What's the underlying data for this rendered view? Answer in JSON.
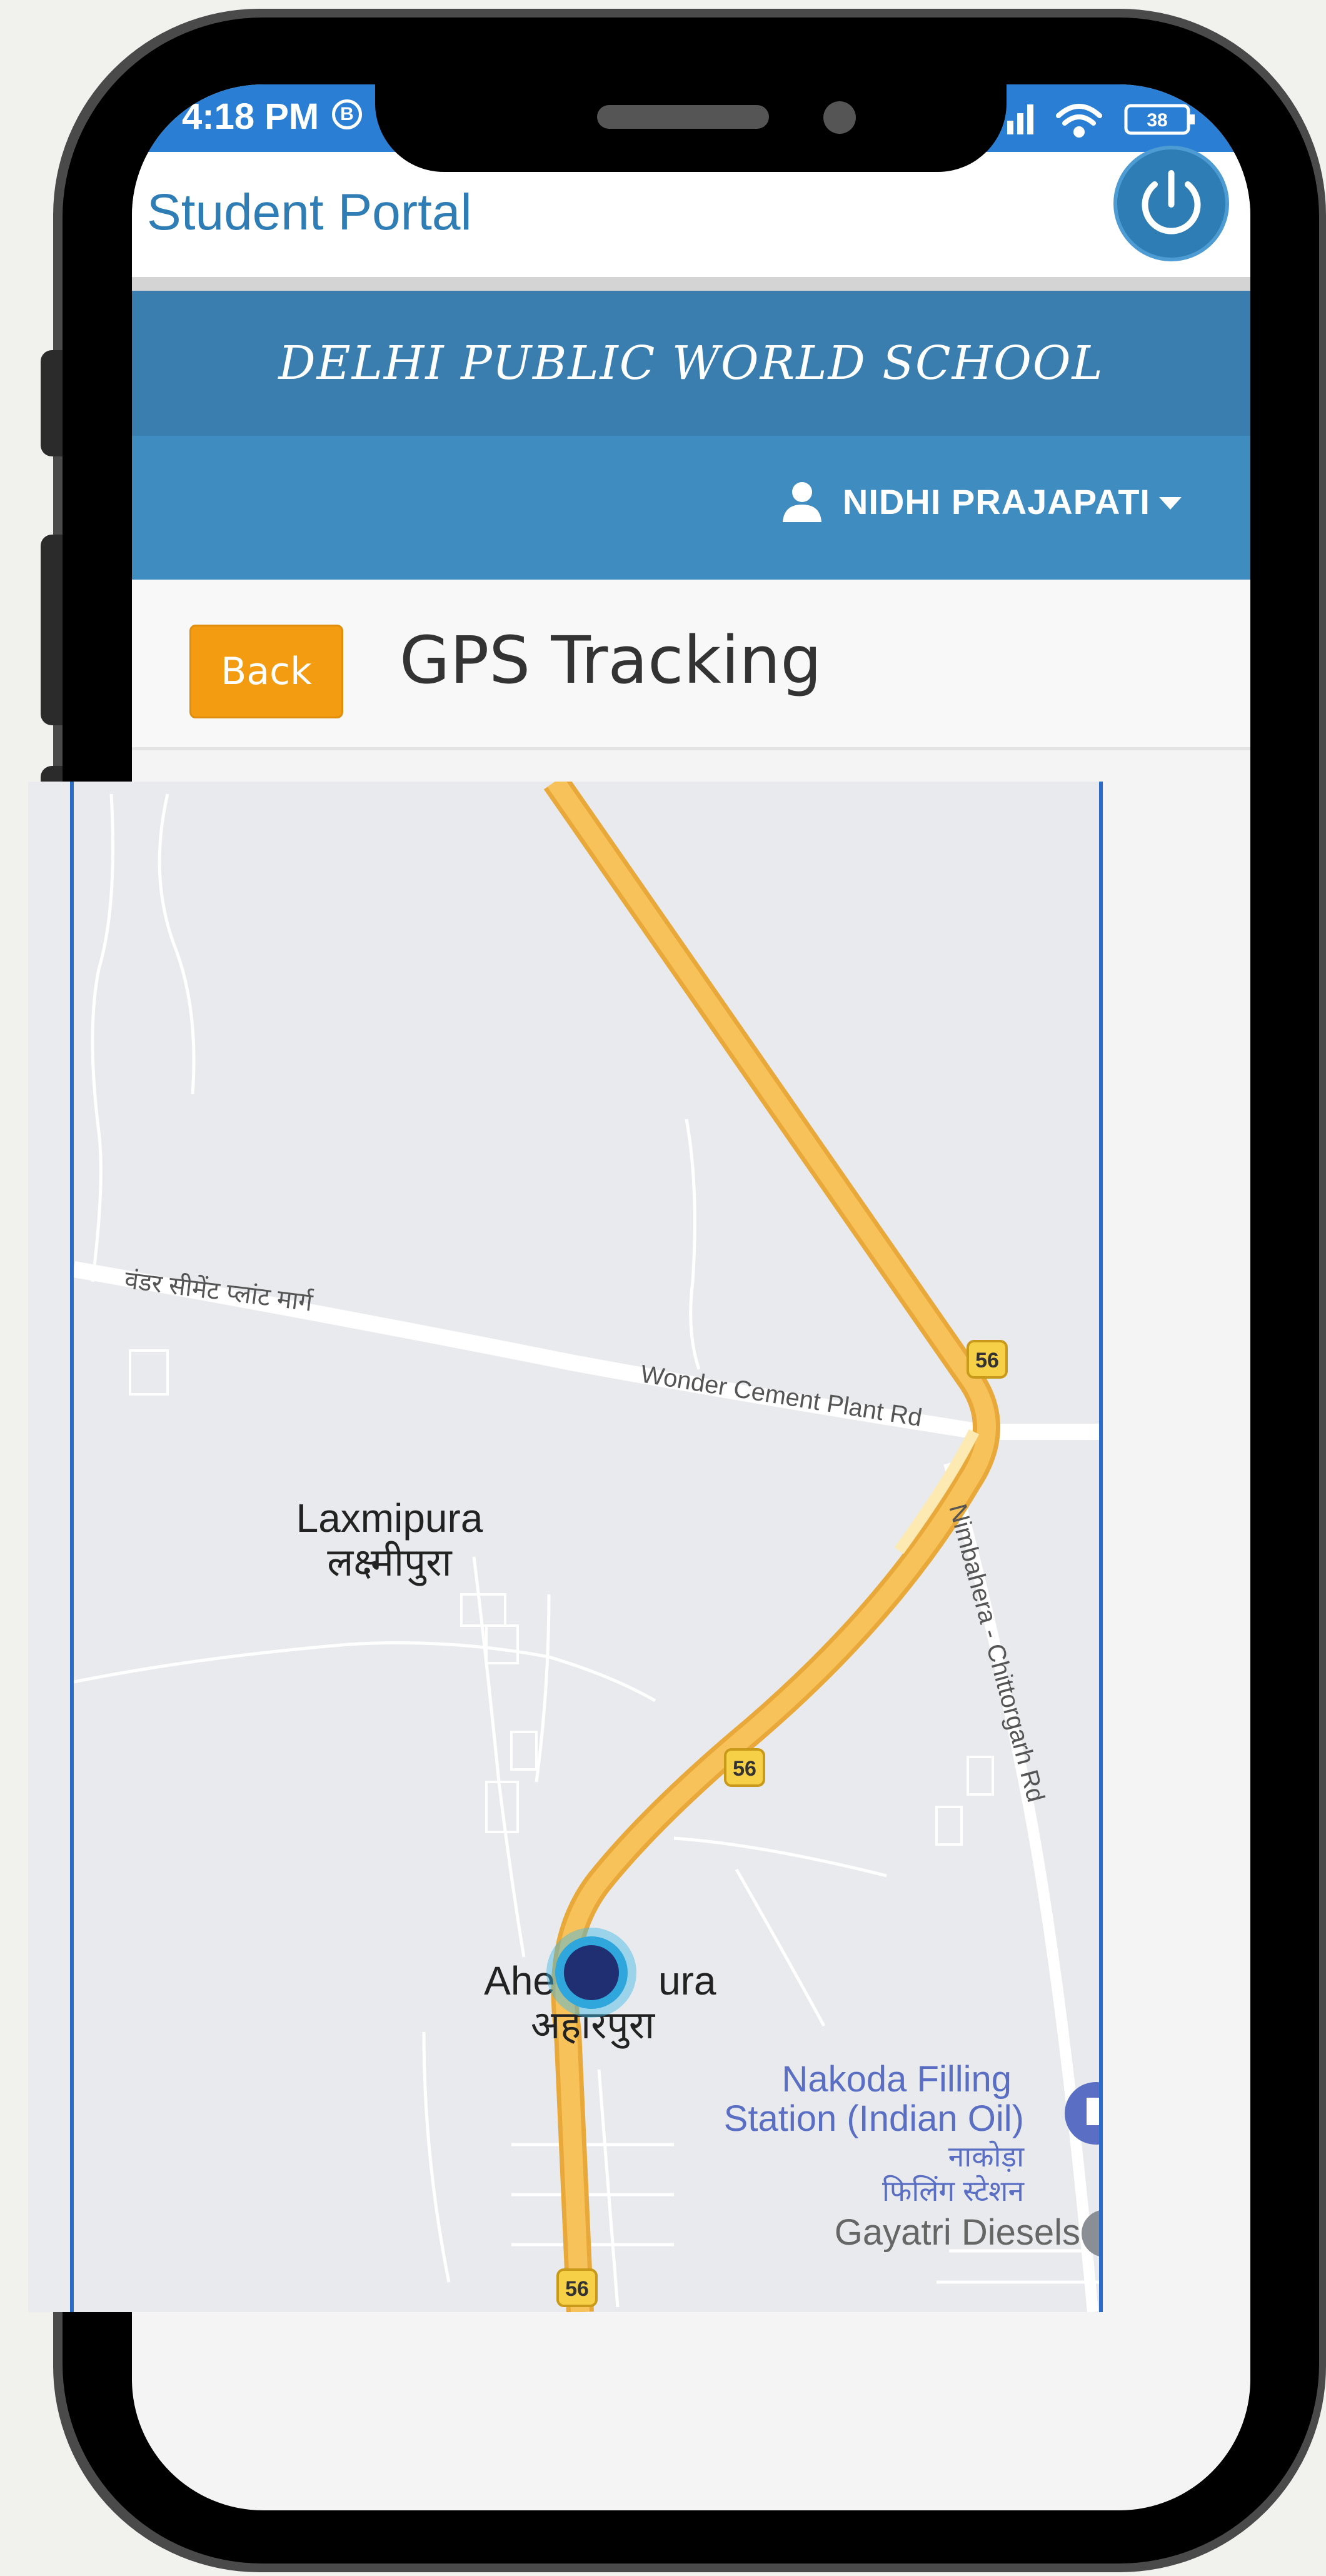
{
  "status_bar": {
    "time": "4:18 PM",
    "b_indicator": "B",
    "battery": "38",
    "icons": [
      "signal-icon",
      "wifi-icon",
      "battery-icon"
    ]
  },
  "app": {
    "title": "Student Portal",
    "power_icon": "power-icon"
  },
  "school": {
    "name": "DELHI PUBLIC WORLD SCHOOL"
  },
  "user": {
    "name": "NIDHI PRAJAPATI",
    "icon": "user-icon"
  },
  "page": {
    "back_label": "Back",
    "title": "GPS Tracking"
  },
  "map": {
    "labels": {
      "road_hindi": "वंडर सीमेंट प्लांट मार्ग",
      "road_english": "Wonder Cement Plant Rd",
      "side_road": "Nimbahera - Chittorgarh Rd",
      "village1_en": "Laxmipura",
      "village1_hi": "लक्ष्मीपुरा",
      "village2_en_a": "Ahe",
      "village2_en_b": "ura",
      "village2_hi": "अहारपुरा",
      "poi1_en_line1": "Nakoda Filling",
      "poi1_en_line2": "Station (Indian Oil)",
      "poi1_hi_line1": "नाकोड़ा",
      "poi1_hi_line2": "फिलिंग स्टेशन",
      "poi2": "Gayatri Diesels",
      "shield1": "56",
      "shield2": "56",
      "shield3": "56"
    },
    "colors": {
      "highway": "#f7c259",
      "highway_edge": "#e8a93a",
      "road": "#ffffff",
      "marker_glow": "#3fb9e8",
      "marker": "#1f2f72",
      "poi_blue": "#5a6fc4"
    }
  }
}
